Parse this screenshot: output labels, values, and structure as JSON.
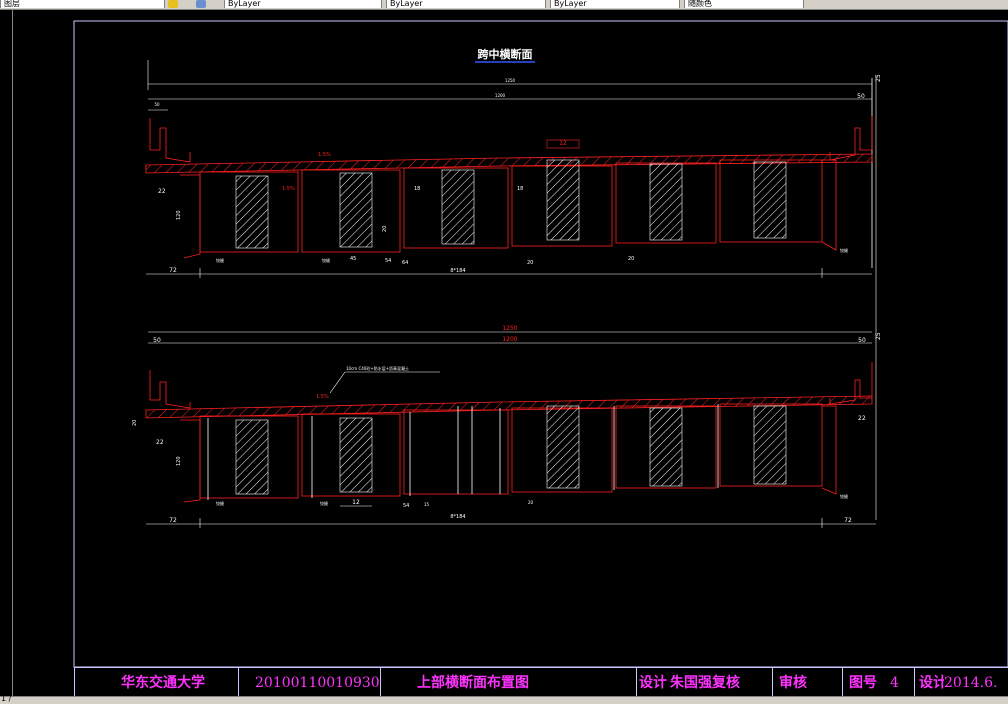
{
  "toolbar": {
    "layer_combo": "图层",
    "linetype_a": "ByLayer",
    "linetype_b": "ByLayer",
    "lineweight": "ByLayer",
    "plotstyle": "随颜色"
  },
  "status": {
    "coords": "1 /"
  },
  "drawing": {
    "title": "跨中横断面",
    "top_section": {
      "total_width": "1250",
      "deck_width": "1200",
      "right_end": "50",
      "height_label": "25",
      "left_mark": "50",
      "slope_label": "1.5%",
      "slope_label_b": "1.5%",
      "void_width": "12",
      "side_left": "22",
      "beam_depth": "120",
      "web_a": "18",
      "web_b": "18",
      "flange_a": "45",
      "flange_b": "20",
      "flange_c": "64",
      "flange_d": "54",
      "chamfer_a": "20",
      "chamfer_b": "20",
      "bearing_label": "铰缝",
      "bearing_label_b": "铰缝",
      "bearing_label_c": "铰缝",
      "left_offset": "72",
      "span_label": "8*184"
    },
    "bottom_section": {
      "total_width": "1250",
      "deck_width": "1200",
      "left_end": "50",
      "right_end": "50",
      "height_label": "25",
      "pave_label": "10cm C40砼+防水层+沥青混凝土",
      "slope_label": "1.5%",
      "side_left": "22",
      "side_right": "22",
      "height_left": "20",
      "beam_depth": "120",
      "void_width": "12",
      "flange_a": "54",
      "chamfer_a": "15",
      "chamfer_b": "20",
      "bearing_label": "铰缝",
      "bearing_label_b": "铰缝",
      "bearing_label_c": "铰缝",
      "left_offset": "72",
      "right_offset": "72",
      "span_label": "8*184"
    }
  },
  "title_block": {
    "school": "华东交通大学",
    "student_id": "20100110010930",
    "drawing_name": "上部横断面布置图",
    "design_label": "设计",
    "designer": "朱国强复核",
    "review_label": "审核",
    "sheet_label": "图号",
    "sheet_no": "4",
    "date_label": "设计",
    "date": "2014.6."
  },
  "colors": {
    "structure": "#ff2020",
    "dimension": "#ffffff",
    "hatch": "#ffffff",
    "title_text": "#ff33ff",
    "frame": "#c8c8ff",
    "title_underline": "#3355ff"
  }
}
